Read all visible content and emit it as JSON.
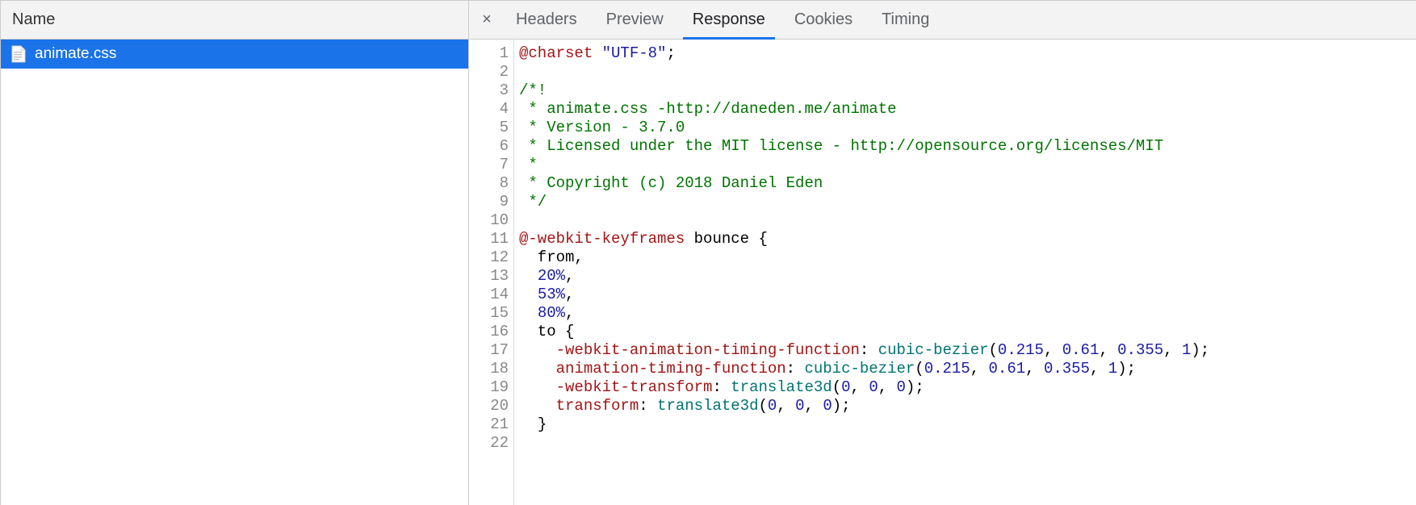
{
  "leftPanel": {
    "header": "Name",
    "files": [
      {
        "name": "animate.css",
        "selected": true
      }
    ]
  },
  "tabs": {
    "close": "×",
    "items": [
      {
        "label": "Headers",
        "active": false
      },
      {
        "label": "Preview",
        "active": false
      },
      {
        "label": "Response",
        "active": true
      },
      {
        "label": "Cookies",
        "active": false
      },
      {
        "label": "Timing",
        "active": false
      }
    ]
  },
  "code": {
    "lines": [
      {
        "n": 1,
        "tokens": [
          {
            "t": "atrule",
            "v": "@charset"
          },
          {
            "t": "plain",
            "v": " "
          },
          {
            "t": "string",
            "v": "\"UTF-8\""
          },
          {
            "t": "punc",
            "v": ";"
          }
        ]
      },
      {
        "n": 2,
        "tokens": []
      },
      {
        "n": 3,
        "tokens": [
          {
            "t": "comment",
            "v": "/*!"
          }
        ]
      },
      {
        "n": 4,
        "tokens": [
          {
            "t": "comment",
            "v": " * animate.css -http://daneden.me/animate"
          }
        ]
      },
      {
        "n": 5,
        "tokens": [
          {
            "t": "comment",
            "v": " * Version - 3.7.0"
          }
        ]
      },
      {
        "n": 6,
        "tokens": [
          {
            "t": "comment",
            "v": " * Licensed under the MIT license - http://opensource.org/licenses/MIT"
          }
        ]
      },
      {
        "n": 7,
        "tokens": [
          {
            "t": "comment",
            "v": " *"
          }
        ]
      },
      {
        "n": 8,
        "tokens": [
          {
            "t": "comment",
            "v": " * Copyright (c) 2018 Daniel Eden"
          }
        ]
      },
      {
        "n": 9,
        "tokens": [
          {
            "t": "comment",
            "v": " */"
          }
        ]
      },
      {
        "n": 10,
        "tokens": []
      },
      {
        "n": 11,
        "tokens": [
          {
            "t": "atrule",
            "v": "@-webkit-keyframes"
          },
          {
            "t": "plain",
            "v": " bounce "
          },
          {
            "t": "punc",
            "v": "{"
          }
        ]
      },
      {
        "n": 12,
        "tokens": [
          {
            "t": "plain",
            "v": "  from"
          },
          {
            "t": "punc",
            "v": ","
          }
        ]
      },
      {
        "n": 13,
        "tokens": [
          {
            "t": "plain",
            "v": "  "
          },
          {
            "t": "number",
            "v": "20%"
          },
          {
            "t": "punc",
            "v": ","
          }
        ]
      },
      {
        "n": 14,
        "tokens": [
          {
            "t": "plain",
            "v": "  "
          },
          {
            "t": "number",
            "v": "53%"
          },
          {
            "t": "punc",
            "v": ","
          }
        ]
      },
      {
        "n": 15,
        "tokens": [
          {
            "t": "plain",
            "v": "  "
          },
          {
            "t": "number",
            "v": "80%"
          },
          {
            "t": "punc",
            "v": ","
          }
        ]
      },
      {
        "n": 16,
        "tokens": [
          {
            "t": "plain",
            "v": "  to "
          },
          {
            "t": "punc",
            "v": "{"
          }
        ]
      },
      {
        "n": 17,
        "tokens": [
          {
            "t": "plain",
            "v": "    "
          },
          {
            "t": "prop",
            "v": "-webkit-animation-timing-function"
          },
          {
            "t": "punc",
            "v": ": "
          },
          {
            "t": "func",
            "v": "cubic-bezier"
          },
          {
            "t": "punc",
            "v": "("
          },
          {
            "t": "number",
            "v": "0.215"
          },
          {
            "t": "punc",
            "v": ", "
          },
          {
            "t": "number",
            "v": "0.61"
          },
          {
            "t": "punc",
            "v": ", "
          },
          {
            "t": "number",
            "v": "0.355"
          },
          {
            "t": "punc",
            "v": ", "
          },
          {
            "t": "number",
            "v": "1"
          },
          {
            "t": "punc",
            "v": ");"
          }
        ]
      },
      {
        "n": 18,
        "tokens": [
          {
            "t": "plain",
            "v": "    "
          },
          {
            "t": "prop",
            "v": "animation-timing-function"
          },
          {
            "t": "punc",
            "v": ": "
          },
          {
            "t": "func",
            "v": "cubic-bezier"
          },
          {
            "t": "punc",
            "v": "("
          },
          {
            "t": "number",
            "v": "0.215"
          },
          {
            "t": "punc",
            "v": ", "
          },
          {
            "t": "number",
            "v": "0.61"
          },
          {
            "t": "punc",
            "v": ", "
          },
          {
            "t": "number",
            "v": "0.355"
          },
          {
            "t": "punc",
            "v": ", "
          },
          {
            "t": "number",
            "v": "1"
          },
          {
            "t": "punc",
            "v": ");"
          }
        ]
      },
      {
        "n": 19,
        "tokens": [
          {
            "t": "plain",
            "v": "    "
          },
          {
            "t": "prop",
            "v": "-webkit-transform"
          },
          {
            "t": "punc",
            "v": ": "
          },
          {
            "t": "func",
            "v": "translate3d"
          },
          {
            "t": "punc",
            "v": "("
          },
          {
            "t": "number",
            "v": "0"
          },
          {
            "t": "punc",
            "v": ", "
          },
          {
            "t": "number",
            "v": "0"
          },
          {
            "t": "punc",
            "v": ", "
          },
          {
            "t": "number",
            "v": "0"
          },
          {
            "t": "punc",
            "v": ");"
          }
        ]
      },
      {
        "n": 20,
        "tokens": [
          {
            "t": "plain",
            "v": "    "
          },
          {
            "t": "prop",
            "v": "transform"
          },
          {
            "t": "punc",
            "v": ": "
          },
          {
            "t": "func",
            "v": "translate3d"
          },
          {
            "t": "punc",
            "v": "("
          },
          {
            "t": "number",
            "v": "0"
          },
          {
            "t": "punc",
            "v": ", "
          },
          {
            "t": "number",
            "v": "0"
          },
          {
            "t": "punc",
            "v": ", "
          },
          {
            "t": "number",
            "v": "0"
          },
          {
            "t": "punc",
            "v": ");"
          }
        ]
      },
      {
        "n": 21,
        "tokens": [
          {
            "t": "plain",
            "v": "  "
          },
          {
            "t": "punc",
            "v": "}"
          }
        ]
      },
      {
        "n": 22,
        "tokens": []
      }
    ]
  }
}
